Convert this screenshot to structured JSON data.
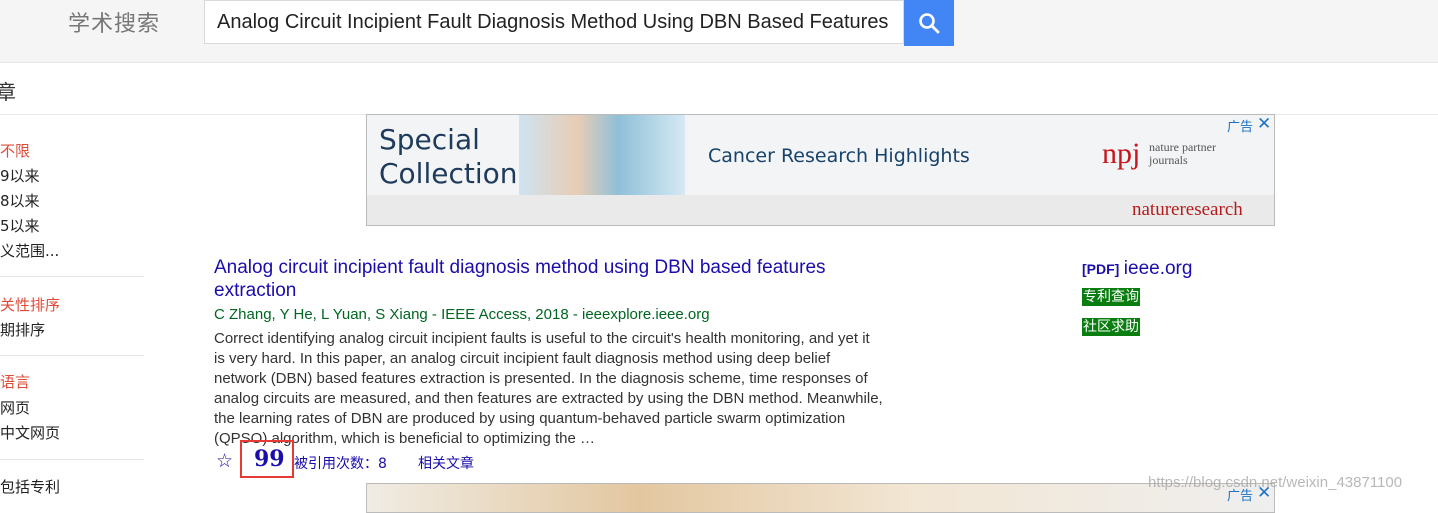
{
  "header": {
    "brand": "学术搜索",
    "search_value": "Analog Circuit Incipient Fault Diagnosis Method Using DBN Based Features E"
  },
  "subbar": {
    "label": "章"
  },
  "sidebar": {
    "time_filters": [
      "不限",
      "9以来",
      "8以来",
      "5以来",
      "义范围..."
    ],
    "sort_options": [
      "关性排序",
      "期排序"
    ],
    "language_options": [
      "语言",
      "网页",
      "中文网页"
    ],
    "patent_option": "包括专利"
  },
  "ad": {
    "title_line1": "Special",
    "title_line2": "Collection",
    "headline": "Cancer Research Highlights",
    "npj": "npj",
    "npj_sub_line1": "nature partner",
    "npj_sub_line2": "journals",
    "brand": "natureresearch",
    "tag": "广告",
    "close": "✕"
  },
  "result": {
    "title": "Analog circuit incipient fault diagnosis method using DBN based features extraction",
    "meta": "C Zhang, Y He, L Yuan, S Xiang - IEEE Access, 2018 - ieeexplore.ieee.org",
    "snippet": "Correct identifying analog circuit incipient faults is useful to the circuit's health monitoring, and yet it is very hard. In this paper, an analog circuit incipient fault diagnosis method using deep belief network (DBN) based features extraction is presented. In the diagnosis scheme, time responses of analog circuits are measured, and then features are extracted by using the DBN method. Meanwhile, the learning rates of DBN are produced by using quantum-behaved particle swarm optimization (QPSO) algorithm, which is beneficial to optimizing the …",
    "star": "☆",
    "cite": "99",
    "cited_by": "被引用次数：8",
    "related": "相关文章"
  },
  "side_links": {
    "pdf_tag": "[PDF]",
    "pdf_domain": "ieee.org",
    "patent_query": "专利查询",
    "community_help": "社区求助"
  },
  "ad2": {
    "tag": "广告",
    "close": "✕"
  },
  "watermark": "https://blog.csdn.net/weixin_43871100"
}
